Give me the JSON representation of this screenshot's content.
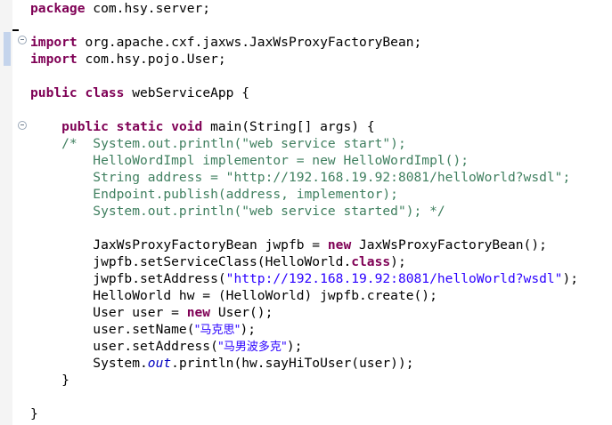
{
  "editor": {
    "package_decl": {
      "kw": "package",
      "name": " com.hsy.server;"
    },
    "imports": [
      {
        "kw": "import",
        "name": " org.apache.cxf.jaxws.JaxWsProxyFactoryBean;"
      },
      {
        "kw": "import",
        "name": " com.hsy.pojo.User;"
      }
    ],
    "class_decl": {
      "kw1": "public",
      "kw2": "class",
      "rest": " webServiceApp {"
    },
    "method_decl": {
      "indent": "    ",
      "kw1": "public",
      "kw2": "static",
      "kw3": "void",
      "rest": " main(String[] args) {"
    },
    "comment_lines": [
      "    /*  System.out.println(\"web service start\");",
      "        HelloWordImpl implementor = new HelloWordImpl();",
      "        String address = \"http://192.168.19.92:8081/helloWorld?wsdl\";",
      "        Endpoint.publish(address, implementor);",
      "        System.out.println(\"web service started\"); */"
    ],
    "body": {
      "l1_a": "        JaxWsProxyFactoryBean jwpfb = ",
      "l1_kw": "new",
      "l1_b": " JaxWsProxyFactoryBean();",
      "l2_a": "        jwpfb.setServiceClass(HelloWorld.",
      "l2_kw": "class",
      "l2_b": ");",
      "l3_a": "        jwpfb.setAddress(",
      "l3_str": "\"http://192.168.19.92:8081/helloWorld?wsdl\"",
      "l3_b": ");",
      "l4": "        HelloWorld hw = (HelloWorld) jwpfb.create();",
      "l5_a": "        User user = ",
      "l5_kw": "new",
      "l5_b": " User();",
      "l6_a": "        user.setName(",
      "l6_str": "\"马克思\"",
      "l6_b": ");",
      "l7_a": "        user.setAddress(",
      "l7_str": "\"马男波多克\"",
      "l7_b": ");",
      "l8_a": "        System.",
      "l8_fld": "out",
      "l8_b": ".println(hw.sayHiToUser(user));",
      "close_method": "    }",
      "close_class": "}"
    }
  }
}
